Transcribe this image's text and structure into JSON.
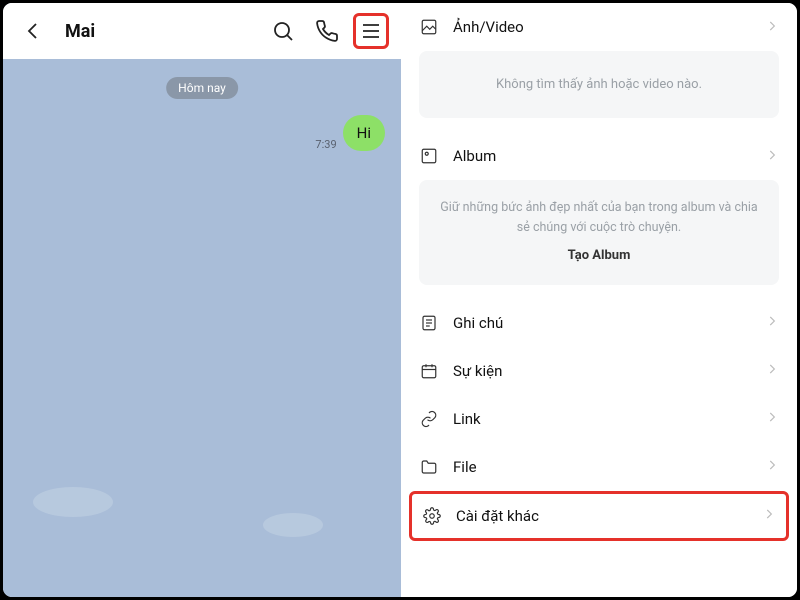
{
  "chat": {
    "name": "Mai",
    "date_label": "Hôm nay",
    "msg_time": "7:39",
    "msg_text": "Hi"
  },
  "panel": {
    "photo_video_label": "Ảnh/Video",
    "photo_empty": "Không tìm thấy ảnh hoặc video nào.",
    "album_label": "Album",
    "album_hint": "Giữ những bức ảnh đẹp nhất của bạn trong album và chia sẻ chúng với cuộc trò chuyện.",
    "album_cta": "Tạo Album",
    "notes_label": "Ghi chú",
    "events_label": "Sự kiện",
    "link_label": "Link",
    "file_label": "File",
    "settings_label": "Cài đặt khác"
  }
}
